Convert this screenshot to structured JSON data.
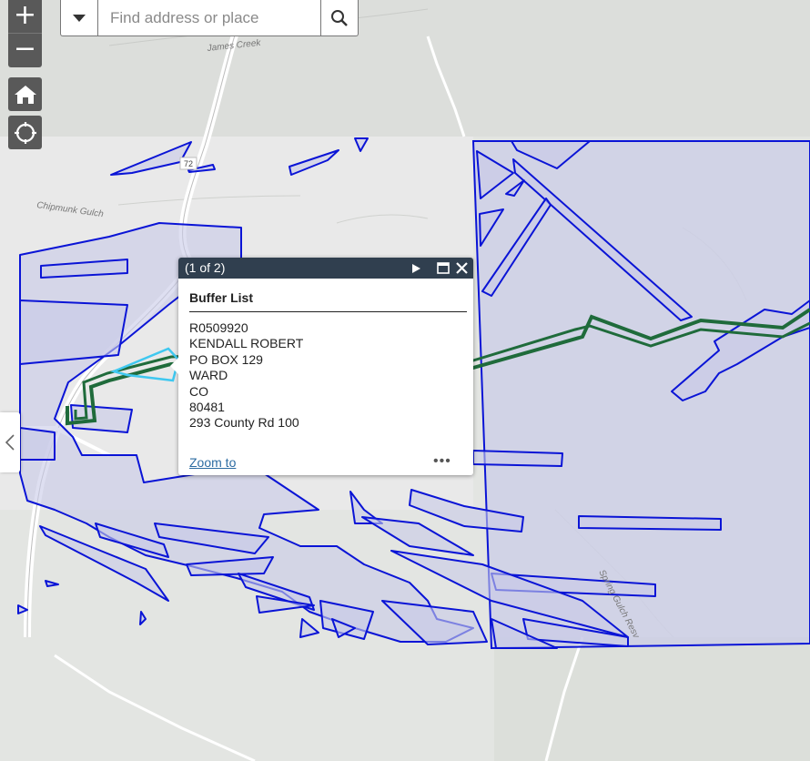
{
  "search": {
    "placeholder": "Find address or place"
  },
  "controls": {
    "zoom_in": "+",
    "zoom_out": "−",
    "home_icon": "home-icon",
    "locate_icon": "locate-icon",
    "sidebar_icon": "chevron-left-icon"
  },
  "map_labels": {
    "creek": "James Creek",
    "gulch": "Chipmunk Gulch",
    "route": "72",
    "reservoir": "Spring Gulch Resv"
  },
  "colors": {
    "parcel_outline": "#0a14d6",
    "parcel_fill": "#c8cae8",
    "buffer_line": "#1f6b3b",
    "selection": "#3fc8f0",
    "popup_header": "#303f4f"
  },
  "popup": {
    "count": "(1 of 2)",
    "title": "Buffer List",
    "attributes": [
      "R0509920",
      "KENDALL ROBERT",
      "PO BOX 129",
      "WARD",
      "CO",
      "80481",
      "293 County Rd 100"
    ],
    "zoom_to": "Zoom to",
    "more": "•••"
  }
}
